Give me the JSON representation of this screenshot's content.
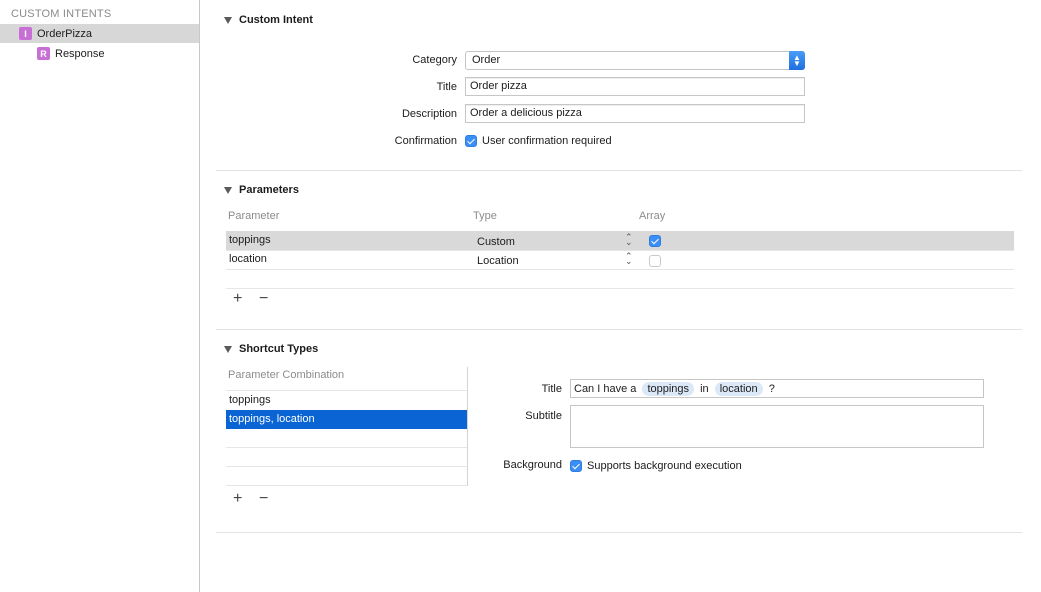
{
  "sidebar": {
    "header": "CUSTOM INTENTS",
    "items": [
      {
        "badge": "I",
        "label": "OrderPizza",
        "selected": true
      },
      {
        "badge": "R",
        "label": "Response",
        "selected": false
      }
    ]
  },
  "custom_intent": {
    "section_title": "Custom Intent",
    "category_label": "Category",
    "category_value": "Order",
    "title_label": "Title",
    "title_value": "Order pizza",
    "description_label": "Description",
    "description_value": "Order a delicious pizza",
    "confirmation_label": "Confirmation",
    "confirmation_text": "User confirmation required",
    "confirmation_checked": true
  },
  "parameters": {
    "section_title": "Parameters",
    "columns": [
      "Parameter",
      "Type",
      "Array"
    ],
    "rows": [
      {
        "name": "toppings",
        "type": "Custom",
        "array": true,
        "selected": true
      },
      {
        "name": "location",
        "type": "Location",
        "array": false,
        "selected": false
      }
    ],
    "add_label": "+",
    "remove_label": "−"
  },
  "shortcut_types": {
    "section_title": "Shortcut Types",
    "list_header": "Parameter Combination",
    "combinations": [
      {
        "label": "toppings",
        "selected": false
      },
      {
        "label": "toppings, location",
        "selected": true
      }
    ],
    "title_label": "Title",
    "title_parts": {
      "prefix": "Can I have a ",
      "token1": "toppings",
      "middle": " in ",
      "token2": "location",
      "suffix": " ?"
    },
    "subtitle_label": "Subtitle",
    "subtitle_value": "",
    "background_label": "Background",
    "background_text": "Supports background execution",
    "background_checked": true,
    "add_label": "+",
    "remove_label": "−"
  },
  "colors": {
    "accent": "#3b8ef5",
    "selection": "#0a64d3",
    "badge": "#c86fd6",
    "token": "#dbe8f8"
  }
}
